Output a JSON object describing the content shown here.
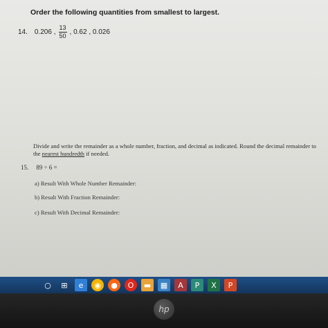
{
  "question14": {
    "header": "Order the following quantities from smallest to largest.",
    "number": "14.",
    "first": "0.206 ,",
    "fraction": {
      "numerator": "13",
      "denominator": "50"
    },
    "rest": ", 0.62 , 0.026"
  },
  "question15": {
    "instructions_a": "Divide and write the remainder as a whole number, fraction, and decimal as indicated. Round the decimal remainder to the",
    "instructions_link": "nearest hundredth",
    "instructions_b": "if needed.",
    "number": "15.",
    "problem": "89 ÷ 6 =",
    "parts": [
      "a)  Result With Whole Number Remainder:",
      "b)  Result With Fraction Remainder:",
      "c)  Result With Decimal Remainder:"
    ]
  },
  "taskbar": {
    "icons": [
      "search-icon",
      "task-view-icon",
      "edge-icon",
      "chrome-icon",
      "firefox-icon",
      "opera-icon",
      "file-explorer-icon",
      "store-icon",
      "access-icon",
      "publisher-icon",
      "excel-icon",
      "powerpoint-icon"
    ],
    "colors": [
      "#1d5a9a",
      "#1a4f8a",
      "#2f7fd6",
      "#f4b400",
      "#ff6611",
      "#e0261c",
      "#e8a33a",
      "#3b82c4",
      "#a4373a",
      "#2b8a78",
      "#207245",
      "#d24726"
    ]
  },
  "bezel": {
    "logo": "hp"
  }
}
